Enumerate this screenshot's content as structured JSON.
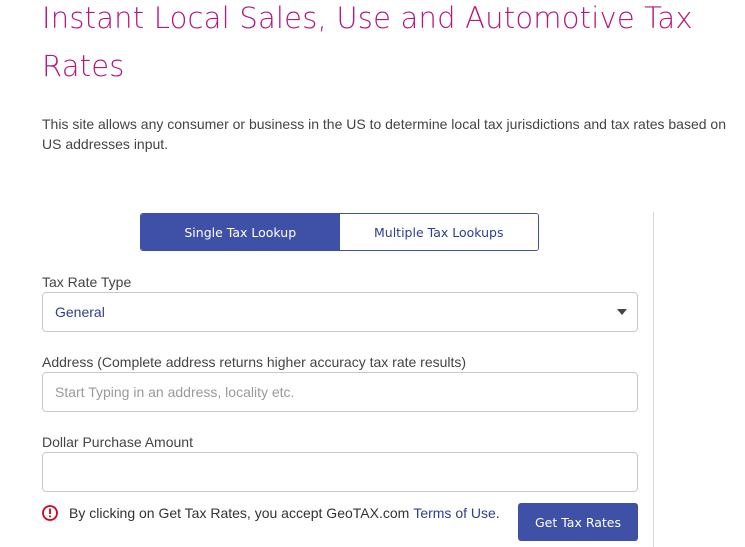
{
  "header": {
    "title": "Instant Local Sales, Use and Automotive Tax Rates",
    "intro": "This site allows any consumer or business in the US to determine local tax jurisdictions and tax rates based on US addresses input."
  },
  "tabs": [
    {
      "label": "Single Tax Lookup",
      "active": true
    },
    {
      "label": "Multiple Tax Lookups",
      "active": false
    }
  ],
  "form": {
    "tax_rate_type": {
      "label": "Tax Rate Type",
      "value": "General"
    },
    "address": {
      "label": "Address (Complete address returns higher accuracy tax rate results)",
      "value": "",
      "placeholder": "Start Typing in an address, locality etc."
    },
    "dollar_amount": {
      "label": "Dollar Purchase Amount",
      "value": "",
      "placeholder": ""
    },
    "consent": {
      "text": "By clicking on Get Tax Rates, you accept GeoTAX.com",
      "link_text": "Terms of Use",
      "suffix": "."
    },
    "submit_label": "Get Tax Rates"
  },
  "icons": {
    "consent": "alert-circle-icon",
    "select": "chevron-down-icon"
  },
  "colors": {
    "title": "#b5177f",
    "primary": "#3f51a6",
    "link": "#2e3f8f",
    "alert": "#d0021b"
  }
}
